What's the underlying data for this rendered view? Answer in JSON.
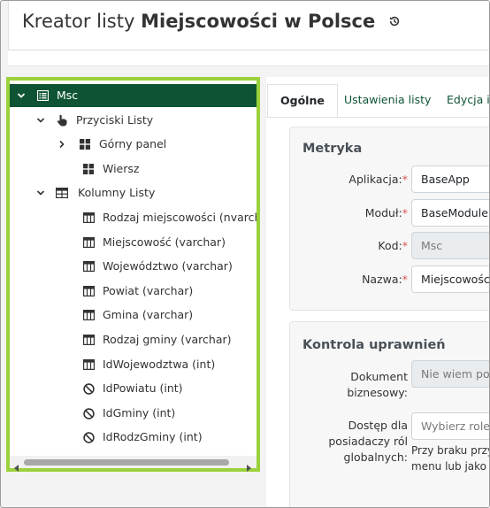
{
  "header": {
    "title_prefix": "Kreator listy",
    "title_name": "Miejscowości w Polsce",
    "history_icon": "history-icon"
  },
  "tree": {
    "items": [
      {
        "label": "Msc",
        "icon": "list-icon",
        "expanded": true,
        "selected": true
      },
      {
        "label": "Przyciski Listy",
        "icon": "hand-pointer-icon",
        "expanded": true
      },
      {
        "label": "Górny panel",
        "icon": "grid-icon",
        "expanded": false
      },
      {
        "label": "Wiersz",
        "icon": "grid-icon"
      },
      {
        "label": "Kolumny Listy",
        "icon": "table-icon",
        "expanded": true
      },
      {
        "label": "Rodzaj miejscowości (nvarchar)",
        "icon": "column-icon"
      },
      {
        "label": "Miejscowość (varchar)",
        "icon": "column-icon"
      },
      {
        "label": "Województwo (varchar)",
        "icon": "column-icon"
      },
      {
        "label": "Powiat (varchar)",
        "icon": "column-icon"
      },
      {
        "label": "Gmina (varchar)",
        "icon": "column-icon"
      },
      {
        "label": "Rodzaj gminy (varchar)",
        "icon": "column-icon"
      },
      {
        "label": "IdWojewodztwa (int)",
        "icon": "column-icon"
      },
      {
        "label": "IdPowiatu (int)",
        "icon": "ban-icon"
      },
      {
        "label": "IdGminy (int)",
        "icon": "ban-icon"
      },
      {
        "label": "IdRodzGminy (int)",
        "icon": "ban-icon"
      }
    ]
  },
  "tabs": [
    {
      "label": "Ogólne",
      "active": true
    },
    {
      "label": "Ustawienia listy"
    },
    {
      "label": "Edycja i"
    }
  ],
  "metryka": {
    "title": "Metryka",
    "fields": [
      {
        "label": "Aplikacja:",
        "required": "*",
        "value": "BaseApp"
      },
      {
        "label": "Moduł:",
        "required": "*",
        "value": "BaseModule"
      },
      {
        "label": "Kod:",
        "required": "*",
        "value": "Msc",
        "disabled": true
      },
      {
        "label": "Nazwa:",
        "required": "*",
        "value": "Miejscowości"
      }
    ]
  },
  "kontrola": {
    "title": "Kontrola uprawnień",
    "dokument_label_1": "Dokument",
    "dokument_label_2": "biznesowy:",
    "dokument_placeholder": "Nie wiem po",
    "dostep_label_1": "Dostęp dla",
    "dostep_label_2": "posiadaczy ról",
    "dostep_label_3": "globalnych:",
    "dostep_placeholder": "Wybierz role",
    "help_1": "Przy braku przy",
    "help_2": "menu lub jako"
  },
  "colors": {
    "brand_green": "#0e5434",
    "highlight_border": "#9bd13a",
    "required": "#d9534f"
  }
}
